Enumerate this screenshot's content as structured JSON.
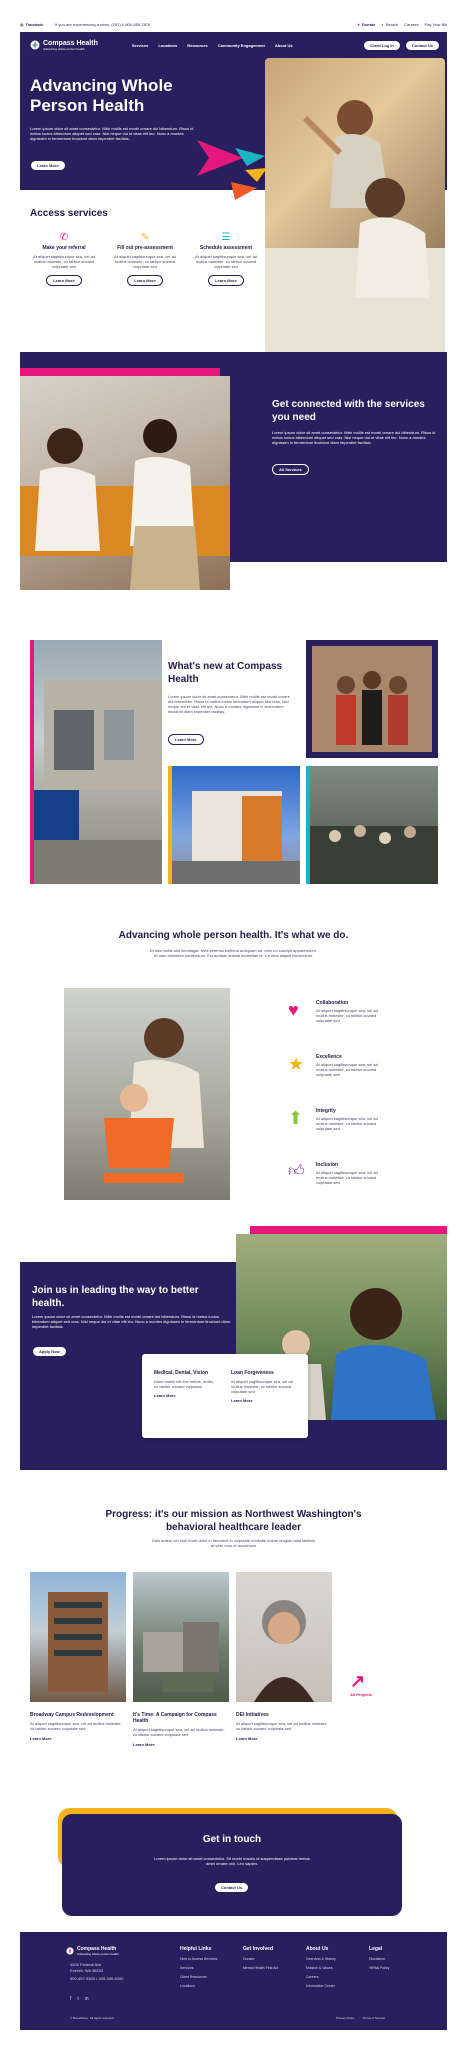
{
  "top_bar": {
    "translate": "Translate",
    "crisis_text": "If you are experiencing a crisis, (251) 1-800-555-7878",
    "donate": "Donate",
    "search": "Search",
    "careers": "Careers",
    "pay_bill": "Pay Your Bill"
  },
  "header": {
    "logo_name": "Compass Health",
    "logo_tagline": "Advancing whole person health",
    "nav": [
      "Services",
      "Locations",
      "Resources",
      "Community Engagement",
      "About Us"
    ],
    "client_login": "Client Log In",
    "contact": "Contact Us"
  },
  "hero": {
    "title": "Advancing Whole Person Health",
    "body": "Lorem ipsum dolor sit amet consectetur. Nibh mollis est morbi ornare dui bibendum. Risus id metus luctus bibendum aliquet sed cras. Nisl neque dui et vitae elit leo. Nunc a montes dignissim in fermentum tincidunt diam imperdiet facilisis.",
    "button": "Learn More"
  },
  "access": {
    "title": "Access services",
    "cards": [
      {
        "icon": "phone-icon",
        "title": "Make your referral",
        "body": "At aliquet sagittisunque sea, vel ad mollus molestie, cu tabitur suvand vulputate sed",
        "button": "Learn More"
      },
      {
        "icon": "pencil-icon",
        "title": "Fill out pre-assessment",
        "body": "At aliquet sagittisunque sea, vel ad mollus molestie, cu tabitur suvand vulputate sed",
        "button": "Learn More"
      },
      {
        "icon": "list-icon",
        "title": "Schedule assessment",
        "body": "At aliquet sagittisunque sea, vel ad mollus molestie, cu tabitur suvand vulputate sed",
        "button": "Learn More"
      }
    ]
  },
  "connected": {
    "title": "Get connected with the services you need",
    "body": "Lorem ipsum dolor sit amet consectetur. Nibh mollis est morbi ornare dui bibendum. Risus id metus luctus bibendum aliquet sed cras. Nisl neque dui et vitae elit leo. Nunc a montes dignissim in fermentum tincidunt diam imperdiet facilisis.",
    "button": "All Services"
  },
  "news": {
    "title": "What's new at Compass Health",
    "body": "Lorem ipsum dolor sit amet consectetur. Nibh mollis est morbi ornare dui bibendum. Risus id metus luctus bibendum aliquet sed cras. Nisl neque dui et vitae elit leo. Nunc a montes dignissim in fermentum tincidunt diam imperdiet facilisis.",
    "button": "Learn More"
  },
  "values": {
    "title": "Advancing whole person health. It's what we do.",
    "body": "Et has mollis ullo immitagat. Mea petentio eleifend antiquam ad, nam no suscipit appareretum. At nam minimum partiendum. Est audiam animal molestiae te. Ce eius aliquid elementum.",
    "items": [
      {
        "icon": "heart-icon",
        "title": "Collaboration",
        "body": "At aliquet sagittisunque sea, vel ad mollus molestie, cu tabitur suvand vulputate sed",
        "color": "#e6177a"
      },
      {
        "icon": "star-icon",
        "title": "Excellence",
        "body": "At aliquet sagittisunque sea, vel ad mollus molestie, cu tabitur suvand vulputate sed",
        "color": "#f6b319"
      },
      {
        "icon": "arrow-up-icon",
        "title": "Integrity",
        "body": "At aliquet sagittisunque sea, vel ad mollus molestie, cu tabitur suvand vulputate sed",
        "color": "#8dc63f"
      },
      {
        "icon": "thumbs-up-icon",
        "title": "Inclusion",
        "body": "At aliquet sagittisunque sea, vel ad mollus molestie, cu tabitur suvand vulputate sed",
        "color": "#8a3a9c"
      }
    ]
  },
  "join": {
    "title": "Join us in leading the way to better health.",
    "body": "Lorem ipsum dolor sit amet consectetur. Nibh mollis est morbi ornare dui bibendum. Risus id metus luctus bibendum aliquet sed cras. Nisl neque dui et vitae elit leo. Nunc a montes dignissim in fermentum tincidunt diam imperdiet facilisis.",
    "button": "Apply Now",
    "cards": [
      {
        "title": "Medical, Dental, Vision",
        "body": "Diam mattis elit tice metus, mollis, cu tabitur suvand vulputate.",
        "link": "Learn More"
      },
      {
        "title": "Loan Forgiveness",
        "body": "At aliquet sagittisunque sea, vel ad mollus molestie, cu tabitur suvand vulputate sed",
        "link": "Learn More"
      }
    ]
  },
  "progress": {
    "title": "Progress: it's our mission as Northwest Washington's behavioral healthcare leader",
    "body": "Duis autem vel eum iriure dolor in hendrerit in vulputate molestie dolore feugiat nulla facilisis at vero eros et accumsan",
    "cards": [
      {
        "title": "Broadway Campus Redevelopment",
        "body": "At aliquet sagittisunque sea, vel ad mollus molestie, cu tabitur suvand vulputate sed",
        "link": "Learn More"
      },
      {
        "title": "It's Time: A Campaign for Compass Health",
        "body": "At aliquet sagittisunque sea, vel ad mollus molestie, cu tabitur suvand vulputate sed",
        "link": "Learn More"
      },
      {
        "title": "DEI Initiatives",
        "body": "At aliquet sagittisunque sea, vel ad mollus molestie, cu tabitur suvand vulputate sed",
        "link": "Learn More"
      }
    ],
    "all_projects": "All Projects"
  },
  "touch": {
    "title": "Get in touch",
    "body": "Lorem ipsum dolor sit amet consectetur. Sit morbi mauris id suspendisse pulvinar metus amet ornare orci. Leo sapien.",
    "button": "Contact Us"
  },
  "footer": {
    "logo_name": "Compass Health",
    "logo_tagline": "Advancing whole person health",
    "address1": "4526 Federal Ave",
    "address2": "Everett, WA 98203",
    "phone": "800-457-9303 • 425-349-6200",
    "copyright": "© BrandStore. All rights reserved",
    "privacy": "Privacy Policy",
    "terms": "Terms of Service",
    "columns": [
      {
        "title": "Helpful Links",
        "links": [
          "How to Access Services",
          "Services",
          "Client Resources",
          "Locations"
        ]
      },
      {
        "title": "Get Involved",
        "links": [
          "Donate",
          "Mental Health First Aid"
        ]
      },
      {
        "title": "About Us",
        "links": [
          "Overview & History",
          "Mission & Values",
          "Careers",
          "Information Center"
        ]
      },
      {
        "title": "Legal",
        "links": [
          "Disclaimer",
          "HIPAA Policy"
        ]
      }
    ]
  },
  "colors": {
    "navy": "#2a1f5e",
    "pink": "#e6177a",
    "yellow": "#f6b319",
    "teal": "#18b4c4",
    "orange": "#f05a28"
  }
}
